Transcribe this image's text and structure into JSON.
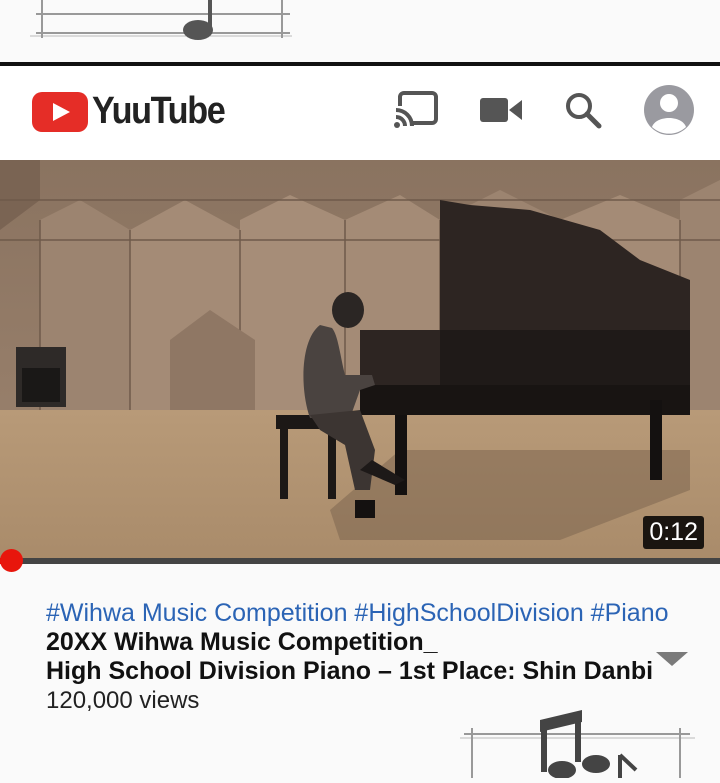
{
  "app": {
    "name": "YuuTube"
  },
  "header_icons": [
    "cast-icon",
    "video-camera-icon",
    "search-icon",
    "avatar-icon"
  ],
  "video": {
    "duration": "0:12",
    "progress_fraction": 0.01
  },
  "meta": {
    "hashtags": "#Wihwa Music Competition #HighSchoolDivision #Piano",
    "title_line1": "20XX Wihwa Music Competition_",
    "title_line2": "High School Division Piano – 1st Place: Shin Danbi",
    "views": "120,000 views"
  },
  "colors": {
    "brand_red": "#e52d27",
    "hashtag_blue": "#2b64b5",
    "progress_red": "#e8160c"
  }
}
